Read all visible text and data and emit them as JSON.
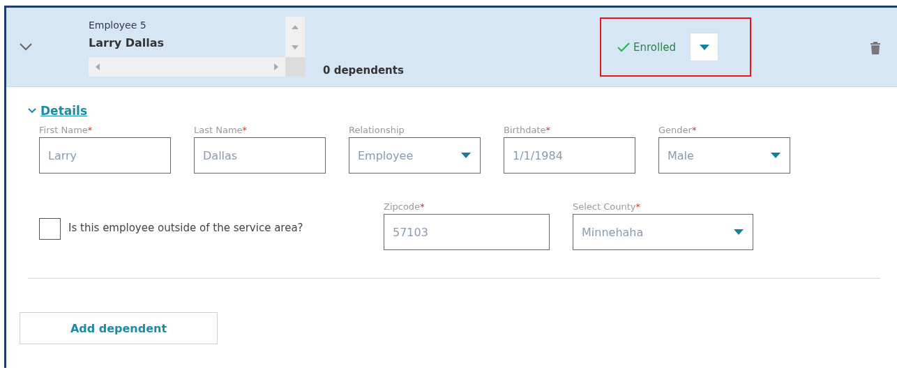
{
  "employee": {
    "caption": "Employee 5",
    "name": "Larry Dallas",
    "dependents": "0 dependents",
    "expanded": true,
    "status": "Enrolled",
    "highlighted": true
  },
  "details": {
    "title": "Details",
    "expanded": true,
    "fields": [
      {
        "label": "First Name",
        "required_mark": "*",
        "value": "Larry",
        "kind": "text"
      },
      {
        "label": "Last Name",
        "required_mark": "*",
        "value": "Dallas",
        "kind": "text"
      },
      {
        "label": "Relationship",
        "value": "Employee",
        "kind": "select"
      },
      {
        "label": "Birthdate",
        "required_mark": "*",
        "value": "1/1/1984",
        "kind": "text"
      },
      {
        "label": "Gender",
        "required_mark": "*",
        "value": "Male",
        "kind": "select"
      }
    ],
    "outside_area": {
      "label": "Is this employee outside of the service area?",
      "checked": false
    },
    "location_fields": [
      {
        "label": "Zipcode",
        "required_mark": "*",
        "value": "57103",
        "kind": "text"
      },
      {
        "label": "Select County",
        "required_mark": "*",
        "value": "Minnehaha",
        "kind": "select"
      }
    ]
  },
  "add_button": "Add dependent"
}
